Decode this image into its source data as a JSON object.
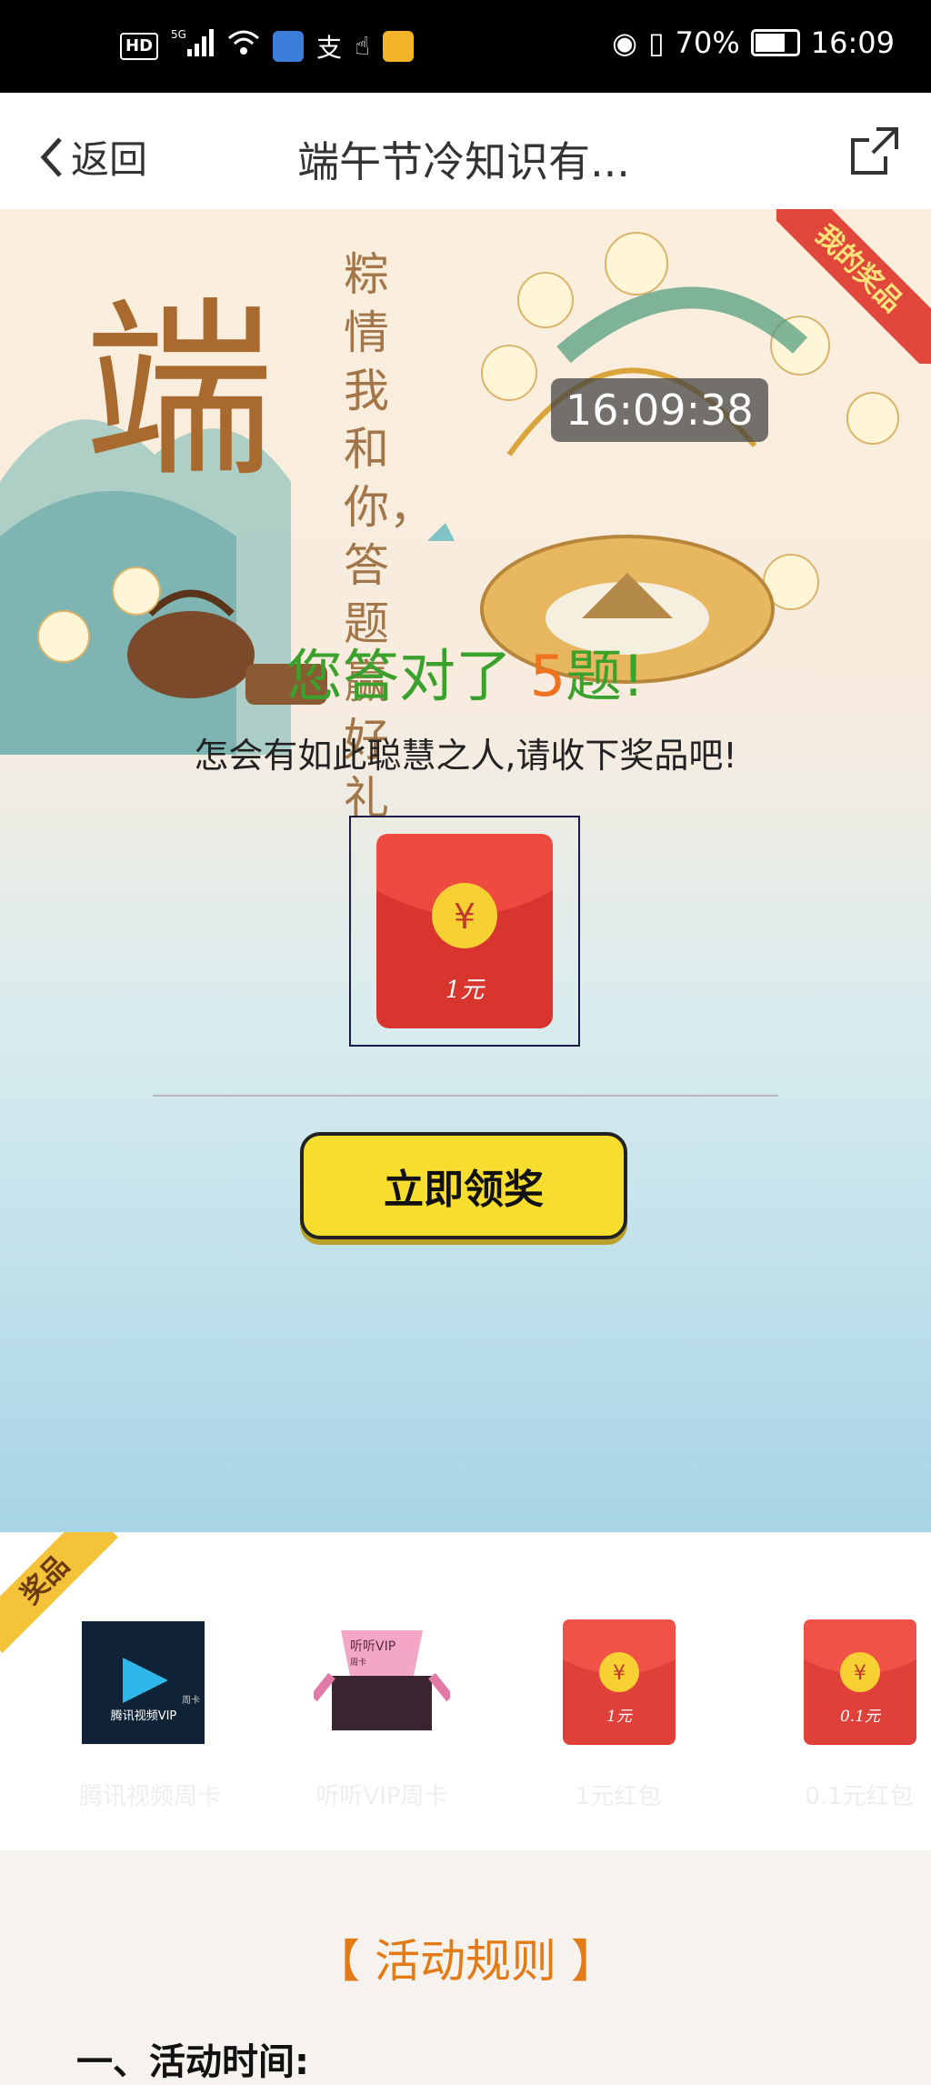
{
  "status_bar": {
    "time": "16:09",
    "battery": "70%",
    "network": "5G",
    "hd": "HD"
  },
  "navbar": {
    "back_label": "返回",
    "title": "端午节冷知识有..."
  },
  "hero": {
    "big_char": "端",
    "vertical_text": "粽情我和你，答题赢好礼",
    "clock": "16:09:38",
    "my_prizes": "我的奖品"
  },
  "result": {
    "prefix": "您答对了",
    "count": "5",
    "suffix": "题!"
  },
  "praise": "怎会有如此聪慧之人,请收下奖品吧!",
  "prize_card": {
    "amount": "1元",
    "symbol": "¥"
  },
  "claim_button": "立即领奖",
  "prizes_section": {
    "tag": "奖品",
    "items": [
      {
        "title": "腾讯视频VIP",
        "sub": "周卡",
        "label": "腾讯视频周卡"
      },
      {
        "title": "听听VIP",
        "sub": "周卡",
        "label": "听听VIP周卡"
      },
      {
        "amount": "1元",
        "label": "1元红包"
      },
      {
        "amount": "0.1元",
        "label": "0.1元红包"
      }
    ]
  },
  "rules": {
    "title": "【 活动规则 】",
    "first_heading": "一、活动时间:"
  }
}
